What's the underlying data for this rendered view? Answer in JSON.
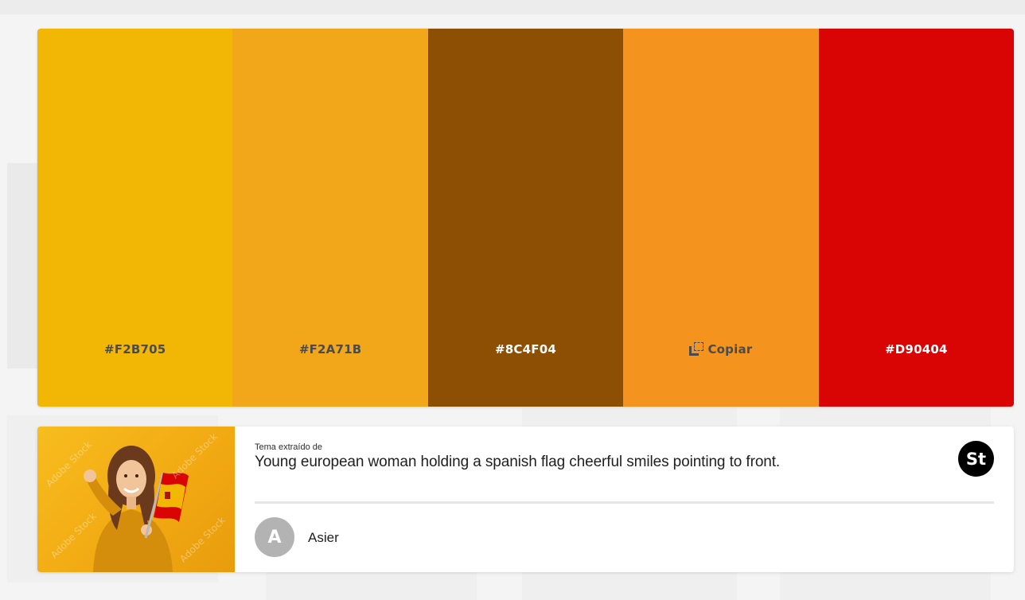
{
  "palette": {
    "swatches": [
      {
        "label": "#F2B705",
        "color": "#F2B705",
        "text_color": "#4b4b4b"
      },
      {
        "label": "#F2A71B",
        "color": "#F2A71B",
        "text_color": "#4b4b4b"
      },
      {
        "label": "#8C4F04",
        "color": "#8C4F04",
        "text_color": "#ffffff"
      },
      {
        "label": "Copiar",
        "color": "#F4931E",
        "text_color": "#4b4b4b",
        "icon": "copy-icon"
      },
      {
        "label": "#D90404",
        "color": "#D90404",
        "text_color": "#ffffff"
      }
    ]
  },
  "source": {
    "extracted_label": "Tema extraído de",
    "title": "Young european woman holding a spanish flag cheerful smiles pointing to front.",
    "logo_text": "St",
    "thumbnail_icon": "stock-photo-thumbnail",
    "watermark": "Adobe Stock"
  },
  "author": {
    "initial": "A",
    "name": "Asier"
  }
}
